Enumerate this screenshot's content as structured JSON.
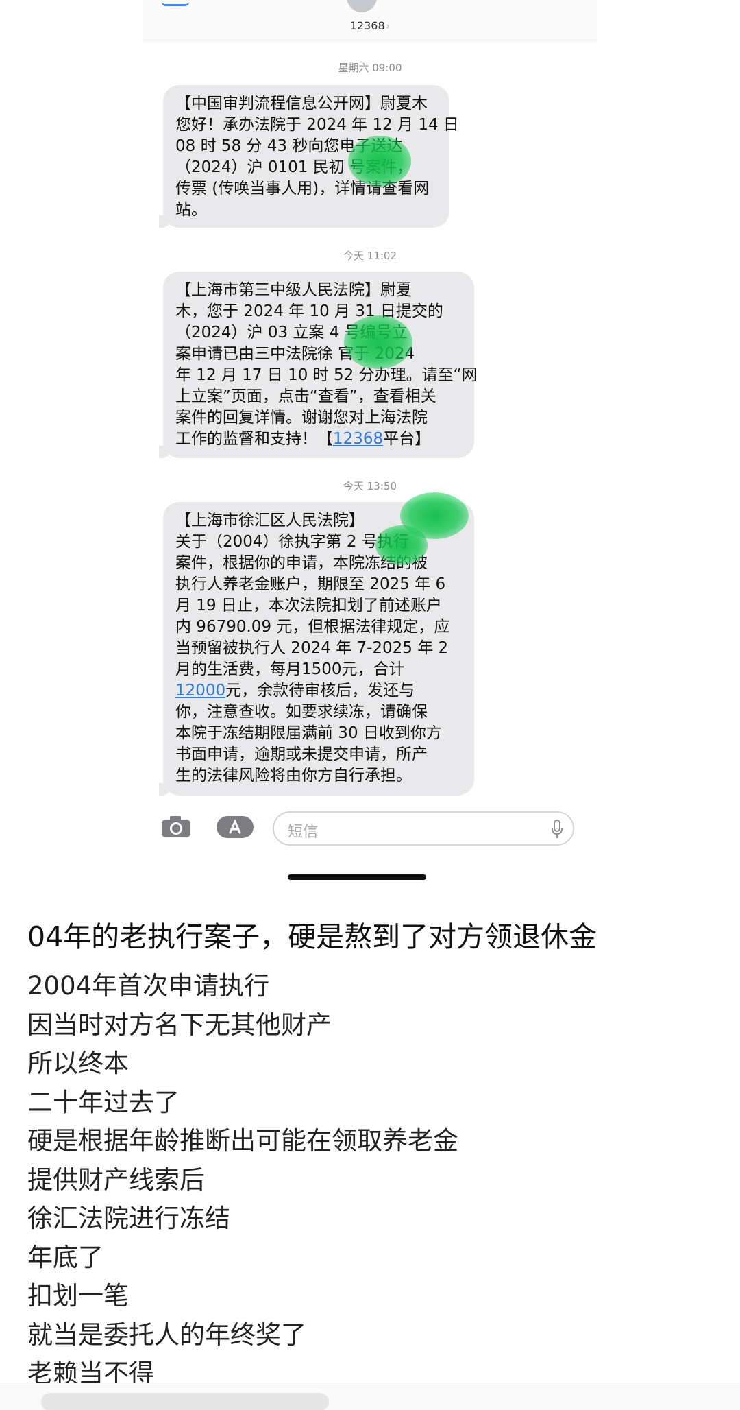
{
  "contact": {
    "name": "12368",
    "chevron": "›"
  },
  "messages": [
    {
      "timestamp": "星期六 09:00",
      "lines": [
        "【中国审判流程信息公开网】尉夏木",
        "您好！承办法院于 2024 年 12 月 14 日",
        "08 时 58 分 43 秒向您电子送达",
        "（2024）沪 0101 民初 号案件，",
        "传票 (传唤当事人用)，详情请查看网",
        "站。"
      ]
    },
    {
      "timestamp": "今天 11:02",
      "lines": [
        "【上海市第三中级人民法院】尉夏",
        "木，您于 2024 年 10 月 31 日提交的",
        "（2024）沪 03 立案 4 号编号立",
        "案申请已由三中法院徐 官于 2024",
        "年 12 月 17 日 10 时 52 分办理。请至“网",
        "上立案”页面，点击“查看”，查看相关",
        "案件的回复详情。谢谢您对上海法院",
        "工作的监督和支持！【"
      ],
      "link": "12368",
      "link_suffix": "平台】"
    },
    {
      "timestamp": "今天 13:50",
      "lines": [
        "【上海市徐汇区人民法院】",
        "关于（2004）徐执字第 2 号执行",
        "案件，根据你的申请，本院冻结的被",
        "执行人养老金账户，期限至 2025 年 6",
        "月 19 日止，本次法院扣划了前述账户",
        "内 96790.09 元，但根据法律规定，应",
        "当预留被执行人 2024 年 7-2025 年 2",
        "月的生活费，每月1500元，合计"
      ],
      "link": "12000",
      "link_suffix": "元，余款待审核后，发还与",
      "tail_lines": [
        "你，注意查收。如要求续冻，请确保",
        "本院于冻结期限届满前 30 日收到你方",
        "书面申请，逾期或未提交申请，所产",
        "生的法律风险将由你方自行承担。"
      ]
    }
  ],
  "input": {
    "placeholder": "短信"
  },
  "icons": {
    "camera": "camera-icon",
    "appstore": "app-store-icon",
    "mic": "microphone-icon"
  },
  "post": {
    "title": "04年的老执行案子，硬是熬到了对方领退休金",
    "lines": [
      "2004年首次申请执行",
      "因当时对方名下无其他财产",
      "所以终本",
      "二十年过去了",
      "硬是根据年龄推断出可能在领取养老金",
      "提供财产线索后",
      "徐汇法院进行冻结",
      "年底了",
      "扣划一笔",
      "就当是委托人的年终奖了",
      "老赖当不得"
    ]
  },
  "colors": {
    "bubble": "#e9e9eb",
    "link": "#2f7ad6",
    "redaction": "#14c850"
  }
}
